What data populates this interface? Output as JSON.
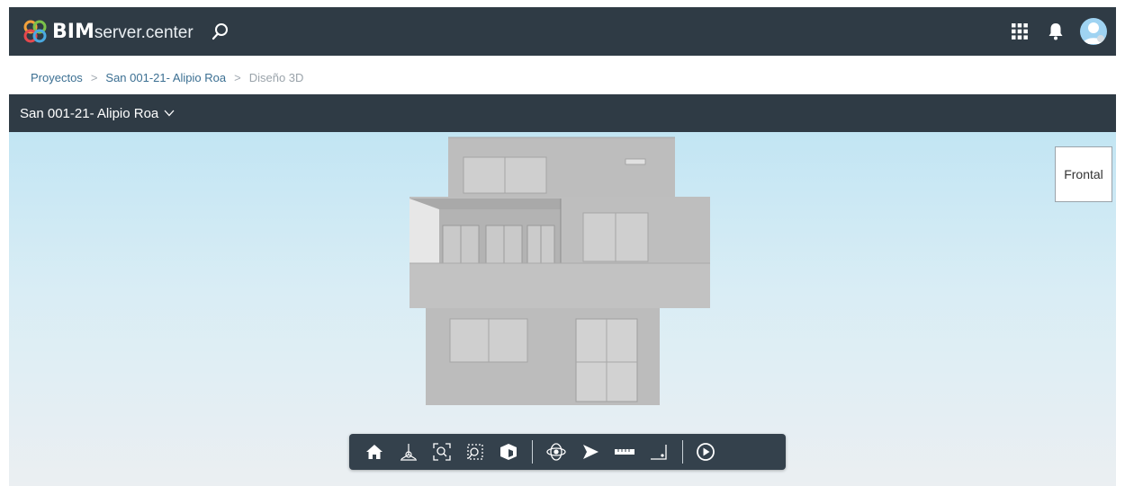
{
  "header": {
    "brand_bold": "BIM",
    "brand_light": "server.center",
    "icons": [
      "logo-icon",
      "search-icon",
      "apps-grid-icon",
      "bell-icon",
      "user-avatar-icon"
    ]
  },
  "breadcrumb": {
    "items": [
      {
        "label": "Proyectos",
        "link": true
      },
      {
        "label": "San 001-21- Alipio Roa",
        "link": true
      },
      {
        "label": "Diseño 3D",
        "link": false
      }
    ],
    "separator": ">"
  },
  "project_bar": {
    "selected_project": "San 001-21- Alipio Roa"
  },
  "viewer": {
    "view_cube_label": "Frontal",
    "toolbar_icons": [
      "home-icon",
      "axes-icon",
      "zoom-extents-icon",
      "zoom-window-icon",
      "section-box-icon",
      "orbit-icon",
      "select-icon",
      "measure-icon",
      "angle-measure-icon",
      "play-icon"
    ]
  },
  "colors": {
    "header_bg": "#2f3b45",
    "link": "#3b6f92",
    "toolbar_bg": "#34414c",
    "sky_top": "#c2e5f3",
    "sky_bottom": "#ebeff2",
    "building": "#bcbcbc"
  }
}
